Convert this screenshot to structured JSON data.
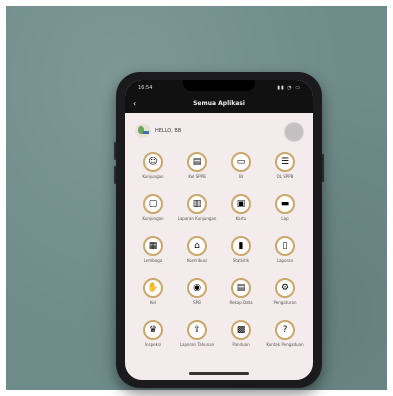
{
  "status_bar": {
    "time": "16:54",
    "indicators": "▮▮ ◔ ▭"
  },
  "header": {
    "back_icon": "chevron-left-icon",
    "title": "Semua Aplikasi"
  },
  "user": {
    "name": "HELLO, BB",
    "logo_icon": "app-logo-icon",
    "avatar_icon": "avatar-icon"
  },
  "apps": [
    {
      "label": "Kunjungan",
      "icon": "person-icon",
      "glyph": "☺"
    },
    {
      "label": "Kel SPPB",
      "icon": "books-icon",
      "glyph": "▤"
    },
    {
      "label": "BI",
      "icon": "folder-icon",
      "glyph": "▭"
    },
    {
      "label": "OL SPPB",
      "icon": "stack-icon",
      "glyph": "☰"
    },
    {
      "label": "Kunjungan",
      "icon": "monitor-icon",
      "glyph": "▢"
    },
    {
      "label": "Laporan Kunjungan",
      "icon": "book-icon",
      "glyph": "▥"
    },
    {
      "label": "Kartu",
      "icon": "card-icon",
      "glyph": "▣"
    },
    {
      "label": "Lap",
      "icon": "laptop-icon",
      "glyph": "▬"
    },
    {
      "label": "Lembaga",
      "icon": "building-icon",
      "glyph": "▦"
    },
    {
      "label": "Kontribusi",
      "icon": "bank-icon",
      "glyph": "⌂"
    },
    {
      "label": "Statistik",
      "icon": "chart-icon",
      "glyph": "▮"
    },
    {
      "label": "Laporan",
      "icon": "document-icon",
      "glyph": "▯"
    },
    {
      "label": "Kel",
      "icon": "hand-icon",
      "glyph": "✋"
    },
    {
      "label": "SPB",
      "icon": "coins-icon",
      "glyph": "◉"
    },
    {
      "label": "Rekap Data",
      "icon": "files-icon",
      "glyph": "▤"
    },
    {
      "label": "Pengaturan",
      "icon": "gear-icon",
      "glyph": "⚙"
    },
    {
      "label": "Inspeksi",
      "icon": "trophy-icon",
      "glyph": "♛"
    },
    {
      "label": "Laporan Tahunan",
      "icon": "upload-icon",
      "glyph": "⇪"
    },
    {
      "label": "Panduan",
      "icon": "box-icon",
      "glyph": "▩"
    },
    {
      "label": "Kontak Pengaduan",
      "icon": "help-icon",
      "glyph": "?"
    }
  ],
  "colors": {
    "background": "#6f8c8a",
    "phone": "#1b1b1d",
    "screen": "#f3ebec",
    "header": "#111111",
    "icon_ring": "#caa86a"
  }
}
